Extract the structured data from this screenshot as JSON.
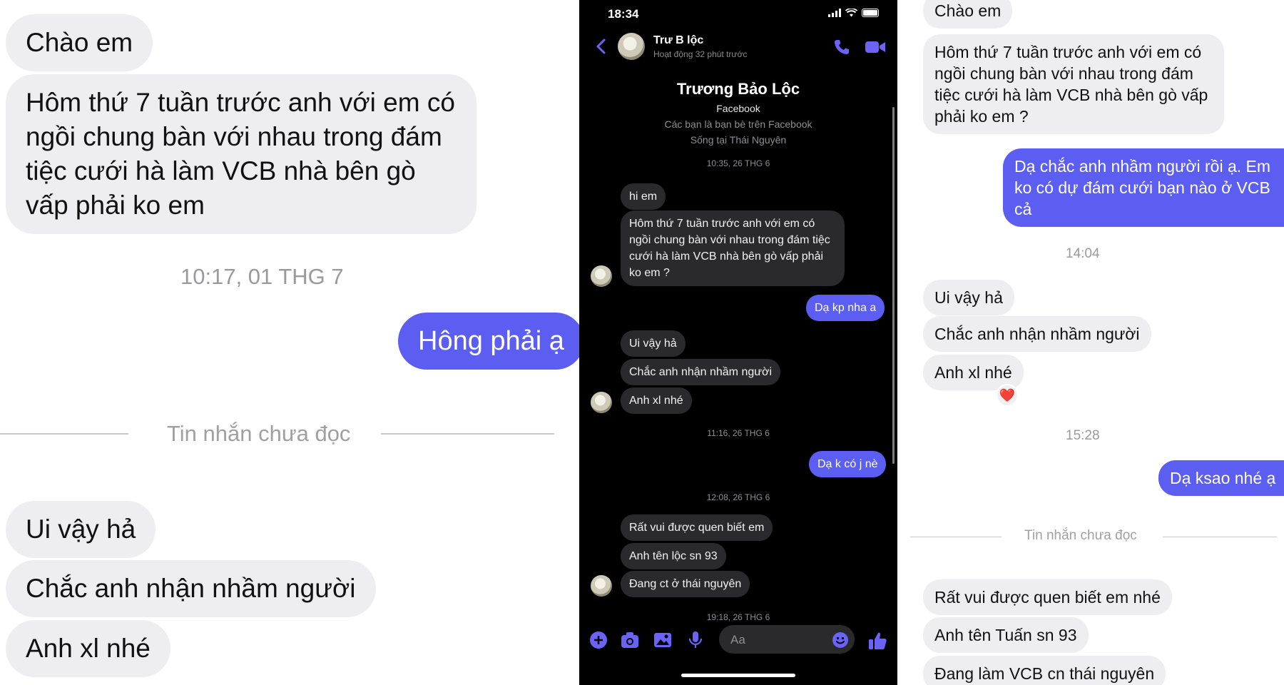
{
  "left_panel": {
    "messages": [
      {
        "text": "Chào em",
        "side": "incoming"
      },
      {
        "text": "Hôm thứ 7 tuần trước anh với em có ngồi chung bàn với nhau trong đám tiệc cưới hà làm VCB nhà bên gò vấp phải ko em",
        "side": "incoming"
      },
      {
        "text": "10:17, 01 THG 7",
        "side": "timestamp"
      },
      {
        "text": "Hông phải ạ",
        "side": "outgoing"
      },
      {
        "text": "Tin nhắn chưa đọc",
        "side": "divider"
      },
      {
        "text": "Ui vậy hả",
        "side": "incoming"
      },
      {
        "text": "Chắc anh nhận nhầm người",
        "side": "incoming"
      },
      {
        "text": "Anh xl nhé",
        "side": "incoming"
      }
    ]
  },
  "phone": {
    "status_time": "18:34",
    "header": {
      "name": "Trư    B    lộc",
      "status": "Hoạt động 32 phút trước"
    },
    "profile": {
      "name": "Trương Bảo Lộc",
      "platform": "Facebook",
      "relation": "Các bạn là bạn bè trên Facebook",
      "location": "Sống tại Thái Nguyên"
    },
    "messages": [
      {
        "text": "10:35, 26 THG 6",
        "side": "timestamp"
      },
      {
        "text": "hi em",
        "side": "incoming"
      },
      {
        "text": "Hôm thứ 7 tuần trước anh với em có ngồi chung bàn với nhau trong đám tiệc cưới hà làm VCB nhà bên gò vấp phải ko em ?",
        "side": "incoming"
      },
      {
        "text": "Dạ kp nha a",
        "side": "outgoing"
      },
      {
        "text": "Ui vậy hả",
        "side": "incoming"
      },
      {
        "text": "Chắc anh nhận nhầm người",
        "side": "incoming"
      },
      {
        "text": "Anh xl nhé",
        "side": "incoming"
      },
      {
        "text": "11:16, 26 THG 6",
        "side": "timestamp"
      },
      {
        "text": "Dạ k có j nè",
        "side": "outgoing"
      },
      {
        "text": "12:08, 26 THG 6",
        "side": "timestamp"
      },
      {
        "text": "Rất vui được quen biết em",
        "side": "incoming"
      },
      {
        "text": "Anh tên lộc sn 93",
        "side": "incoming"
      },
      {
        "text": "Đang ct ở thái nguyên",
        "side": "incoming"
      },
      {
        "text": "19:18, 26 THG 6",
        "side": "timestamp"
      }
    ],
    "composer_placeholder": "Aa",
    "icons": {
      "back": "chevron-left-icon",
      "call": "phone-icon",
      "video": "video-camera-icon",
      "add": "plus-circle-icon",
      "camera": "camera-icon",
      "gallery": "image-icon",
      "mic": "microphone-icon",
      "emoji": "smiley-icon",
      "like": "thumbs-up-icon"
    }
  },
  "right_panel": {
    "messages": [
      {
        "text": "Chào em",
        "side": "incoming"
      },
      {
        "text": "Hôm thứ 7 tuần trước anh với em có ngồi chung bàn với nhau trong đám tiệc cưới hà làm VCB nhà bên gò vấp phải ko em ?",
        "side": "incoming"
      },
      {
        "text": "Dạ chắc anh nhầm người rồi ạ. Em ko có dự đám cưới bạn nào ở VCB cả",
        "side": "outgoing"
      },
      {
        "text": "14:04",
        "side": "timestamp"
      },
      {
        "text": "Ui vậy hả",
        "side": "incoming"
      },
      {
        "text": "Chắc anh nhận nhầm người",
        "side": "incoming"
      },
      {
        "text": "Anh xl nhé",
        "side": "incoming"
      },
      {
        "text": "❤️",
        "side": "reaction"
      },
      {
        "text": "15:28",
        "side": "timestamp"
      },
      {
        "text": "Dạ ksao nhé ạ",
        "side": "outgoing"
      },
      {
        "text": "Tin nhắn chưa đọc",
        "side": "divider"
      },
      {
        "text": "Rất vui được quen biết em nhé",
        "side": "incoming"
      },
      {
        "text": "Anh tên Tuấn sn 93",
        "side": "incoming"
      },
      {
        "text": "Đang làm VCB cn thái nguyên",
        "side": "incoming"
      }
    ]
  },
  "colors": {
    "outgoing_bubble": "#5b5ef0",
    "incoming_light": "#eeeef0",
    "incoming_dark": "#2a2a2c",
    "accent": "#5f5cf5"
  }
}
